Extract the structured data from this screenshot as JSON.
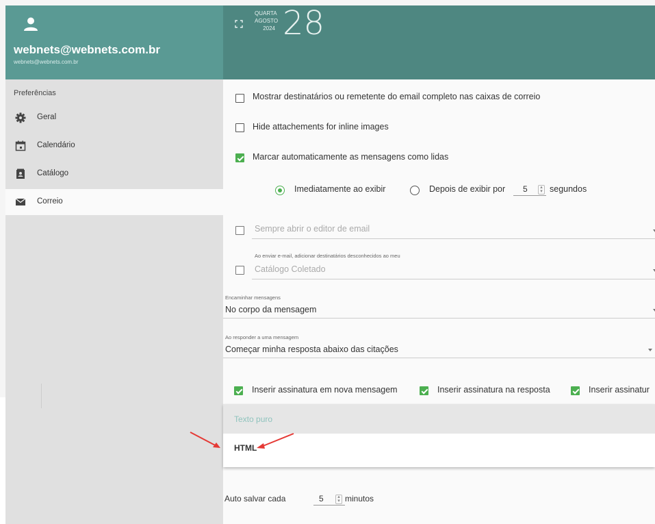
{
  "user": {
    "name": "webnets@webnets.com.br",
    "email": "webnets@webnets.com.br"
  },
  "sidebar": {
    "section_label": "Preferências",
    "items": [
      {
        "label": "Geral",
        "icon": "gear-icon"
      },
      {
        "label": "Calendário",
        "icon": "calendar-icon"
      },
      {
        "label": "Catálogo",
        "icon": "contact-book-icon"
      },
      {
        "label": "Correio",
        "icon": "mail-icon",
        "selected": true
      }
    ]
  },
  "header": {
    "weekday": "QUARTA",
    "month": "AGOSTO",
    "year": "2024",
    "day": "28"
  },
  "mail": {
    "show_recipients_label": "Mostrar destinatários ou remetente do email completo nas caixas de correio",
    "show_recipients_checked": false,
    "hide_attachments_label": "Hide attachements for inline images",
    "hide_attachments_checked": false,
    "mark_read_label": "Marcar automaticamente as mensagens como lidas",
    "mark_read_checked": true,
    "radio_immediately": "Imediatamente ao exibir",
    "radio_after": "Depois de exibir por",
    "after_seconds_value": "5",
    "seconds_label": "segundos",
    "always_open_editor": "Sempre abrir o editor de email",
    "add_recipients_caption": "Ao enviar e-mail, adicionar destinatários desconhecidos ao meu",
    "add_recipients_value": "Catálogo Coletado",
    "forward_caption": "Encaminhar mensagens",
    "forward_value": "No corpo da mensagem",
    "reply_caption": "Ao responder a uma mensagem",
    "reply_value": "Começar minha resposta abaixo das citações",
    "sig_new": "Inserir assinatura em nova mensagem",
    "sig_reply": "Inserir assinatura na resposta",
    "sig_forward": "Inserir assinatur",
    "compose_format_options": [
      "Texto puro",
      "HTML"
    ],
    "compose_format_selected": "HTML",
    "autosave_label": "Auto salvar cada",
    "autosave_value": "5",
    "autosave_unit": "minutos"
  },
  "colors": {
    "sidebar_header": "#5a9a94",
    "topbar": "#4e8781",
    "accent_green": "#4caf50",
    "annotation_red": "#e53935"
  }
}
